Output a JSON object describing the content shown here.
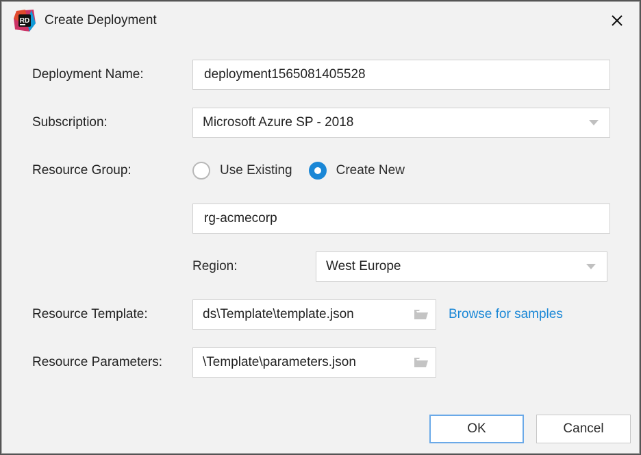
{
  "dialog": {
    "title": "Create Deployment"
  },
  "labels": {
    "deployment_name": "Deployment Name:",
    "subscription": "Subscription:",
    "resource_group": "Resource Group:",
    "region": "Region:",
    "resource_template": "Resource Template:",
    "resource_parameters": "Resource Parameters:"
  },
  "fields": {
    "deployment_name": "deployment1565081405528",
    "subscription": "Microsoft Azure SP - 2018",
    "resource_group_name": "rg-acmecorp",
    "region": "West Europe",
    "template_path": "ds\\Template\\template.json",
    "parameters_path": "\\Template\\parameters.json"
  },
  "radios": {
    "use_existing": "Use Existing",
    "create_new": "Create New",
    "selected": "create_new"
  },
  "actions": {
    "browse_samples": "Browse for samples",
    "ok": "OK",
    "cancel": "Cancel"
  }
}
